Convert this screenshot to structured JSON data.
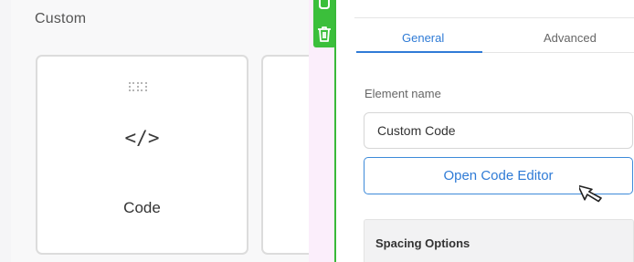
{
  "widgets_panel": {
    "section_title": "Custom",
    "cards": [
      {
        "label": "Code",
        "glyph": "</>",
        "icon": "code-icon",
        "handle_icon": "drag-handle-icon"
      }
    ]
  },
  "canvas_toolbar": {
    "accent": "#3bbf3b",
    "icons": [
      "edit-icon",
      "trash-icon"
    ]
  },
  "settings_panel": {
    "tabs": [
      {
        "label": "General",
        "active": true
      },
      {
        "label": "Advanced",
        "active": false
      }
    ],
    "element_name": {
      "label": "Element name",
      "value": "Custom Code"
    },
    "open_editor_label": "Open Code Editor",
    "sections": [
      {
        "title": "Spacing Options"
      }
    ],
    "accent": "#2f7bd6"
  }
}
